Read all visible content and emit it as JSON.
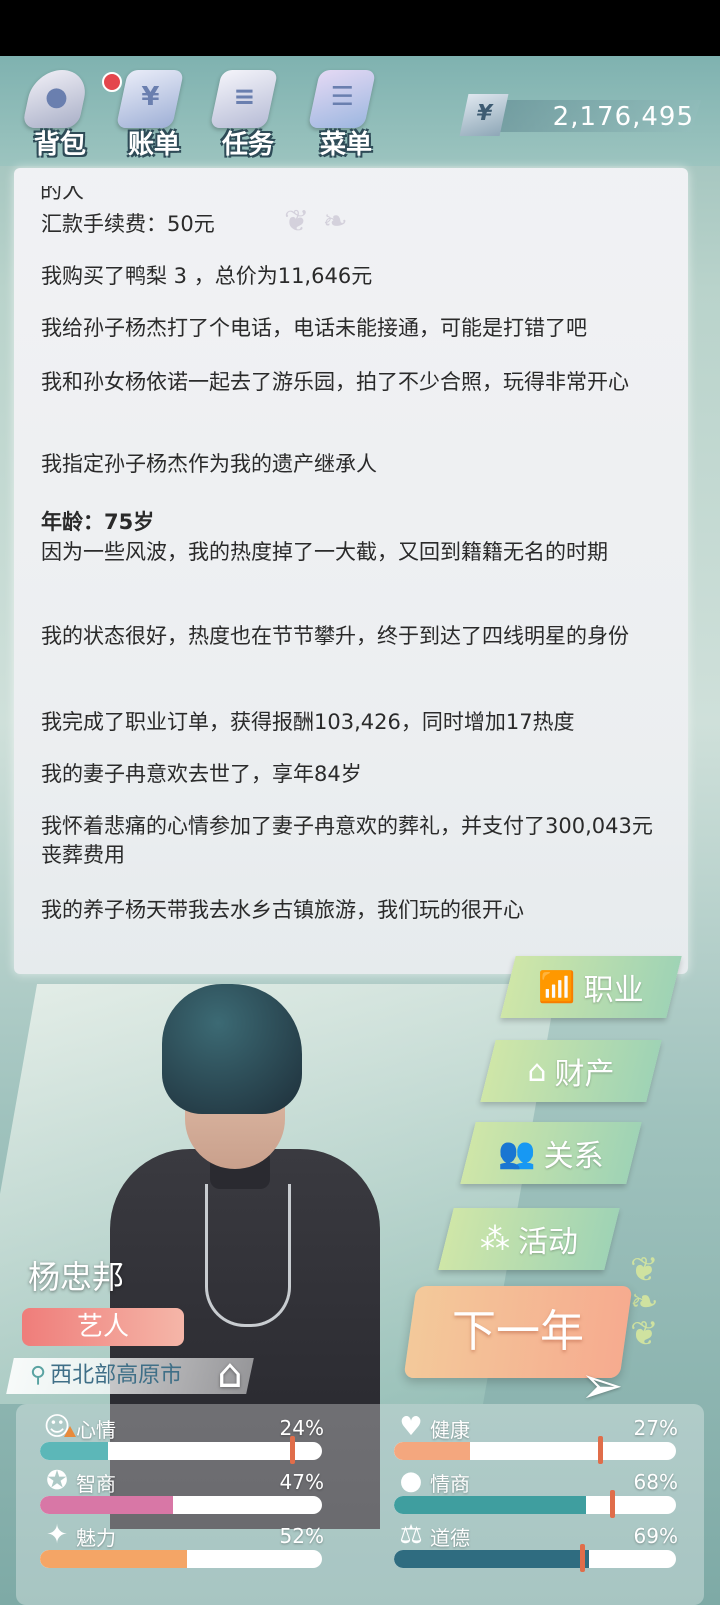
{
  "topbar": {
    "bag_label": "背包",
    "bill_label": "账单",
    "task_label": "任务",
    "menu_label": "菜单",
    "currency_symbol": "¥",
    "money": "2,176,495"
  },
  "log": {
    "cut_line": "的人",
    "lines": [
      "汇款手续费：50元",
      "我购买了鸭梨 3 ，总价为11,646元",
      "我给孙子杨杰打了个电话，电话未能接通，可能是打错了吧",
      "我和孙女杨依诺一起去了游乐园，拍了不少合照，玩得非常开心",
      "我指定孙子杨杰作为我的遗产继承人",
      "年龄：75岁",
      "因为一些风波，我的热度掉了一大截，又回到籍籍无名的时期",
      "我的状态很好，热度也在节节攀升，终于到达了四线明星的身份",
      "我完成了职业订单，获得报酬103,426，同时增加17热度",
      "我的妻子冉意欢去世了，享年84岁",
      "我怀着悲痛的心情参加了妻子冉意欢的葬礼，并支付了300,043元丧葬费用",
      "我的养子杨天带我去水乡古镇旅游，我们玩的很开心"
    ]
  },
  "side": {
    "career": "职业",
    "property": "财产",
    "relation": "关系",
    "activity": "活动"
  },
  "character": {
    "name": "杨忠邦",
    "job": "艺人",
    "location": "西北部高原市"
  },
  "next_year": "下一年",
  "stats": {
    "mood": {
      "label": "心情",
      "value": "24%",
      "fill": 0.24,
      "color": "#5cb7b8"
    },
    "health": {
      "label": "健康",
      "value": "27%",
      "fill": 0.27,
      "color": "#f4a77e"
    },
    "iq": {
      "label": "智商",
      "value": "47%",
      "fill": 0.47,
      "color": "#d877a6"
    },
    "eq": {
      "label": "情商",
      "value": "68%",
      "fill": 0.68,
      "color": "#3f9e9f"
    },
    "charm": {
      "label": "魅力",
      "value": "52%",
      "fill": 0.52,
      "color": "#f4a566"
    },
    "morality": {
      "label": "道德",
      "value": "69%",
      "fill": 0.69,
      "color": "#2f6c80"
    }
  },
  "icons": [
    "bag-icon",
    "bill-icon",
    "task-icon",
    "menu-icon",
    "chart-icon",
    "house-icon",
    "people-icon",
    "bubbles-icon",
    "pin-icon",
    "home-icon",
    "paper-plane-icon",
    "smile-icon",
    "brain-icon",
    "sparkle-icon",
    "heart-icon",
    "apple-icon",
    "scale-icon"
  ]
}
